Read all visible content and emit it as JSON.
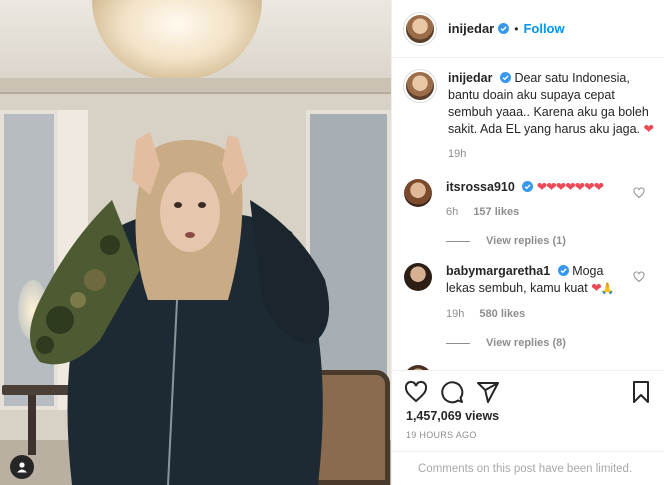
{
  "post": {
    "username": "inijedar",
    "follow_label": "Follow",
    "separator": "•",
    "caption": "Dear satu Indonesia, bantu doain aku supaya cepat sembuh yaaa.. Karena aku ga boleh sakit. Ada EL yang harus aku jaga.",
    "caption_time": "19h",
    "views": "1,457,069 views",
    "timestamp": "19 HOURS AGO",
    "comments_limited": "Comments on this post have been limited."
  },
  "comments": [
    {
      "username": "itsrossa910",
      "text": "❤❤❤❤❤❤❤",
      "time": "6h",
      "likes": "157 likes",
      "replies": "View replies (1)"
    },
    {
      "username": "babymargaretha1",
      "text": "Moga lekas sembuh, kamu kuat",
      "time": "19h",
      "likes": "580 likes",
      "replies": "View replies (8)"
    }
  ],
  "colors": {
    "accent": "#0095f6",
    "heart": "#ed4956",
    "text": "#262626",
    "muted": "#8e8e8e"
  },
  "icons": {
    "verified": "verified-badge-icon",
    "like": "heart-icon",
    "comment": "comment-icon",
    "share": "share-icon",
    "save": "bookmark-icon",
    "user_tag": "user-tag-icon"
  }
}
